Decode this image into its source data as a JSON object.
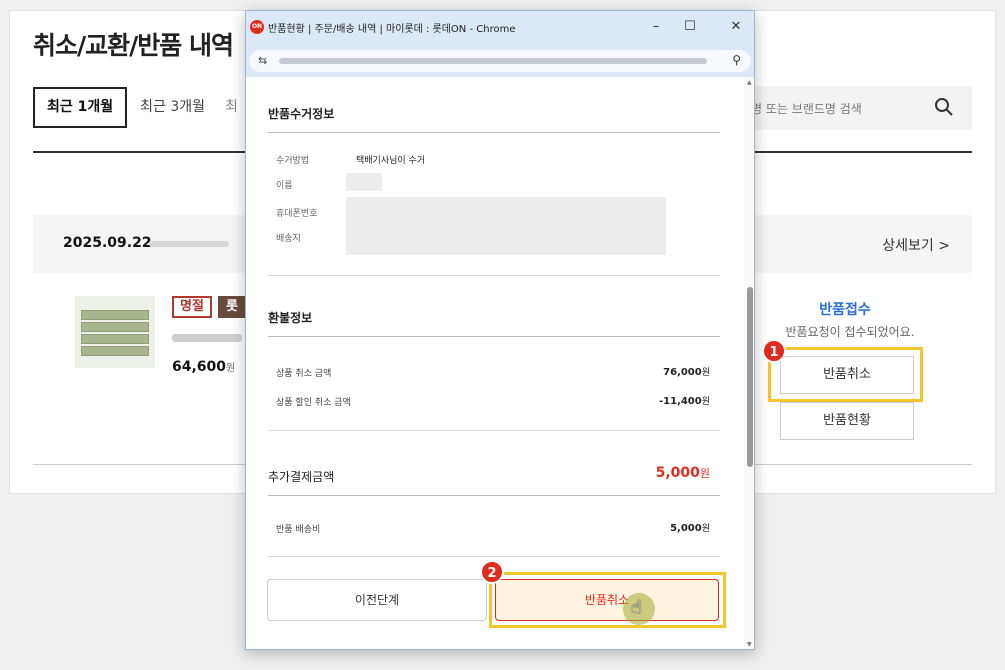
{
  "page": {
    "title": "취소/교환/반품 내역",
    "period_tabs": [
      "최근 1개월",
      "최근 3개월",
      "최"
    ],
    "search_placeholder": "품명 또는 브랜드명 검색",
    "order": {
      "date": "2025.09.22",
      "detail_link": "상세보기 >"
    },
    "product": {
      "badge1": "명절",
      "badge2": "롯",
      "price": "64,600",
      "price_unit": "원"
    },
    "return_status": "반품접수",
    "return_status_msg": "반품요청이 접수되었어요.",
    "buttons": {
      "cancel_return": "반품취소",
      "return_status": "반품현황"
    },
    "steps": [
      "1",
      "2"
    ]
  },
  "popup": {
    "favicon_label": "ON",
    "window_title": "반품현황 | 주문/배송 내역 | 마이롯데 : 롯데ON - Chrome",
    "controls": {
      "minimize": "–",
      "maximize": "☐",
      "close": "✕"
    },
    "url_tune_icon": "⇆",
    "url_zoom_icon": "⚲",
    "pickup": {
      "title": "반품수거정보",
      "fields": [
        {
          "label": "수거방법",
          "value": "택배기사님이 수거"
        },
        {
          "label": "이름",
          "value": ""
        },
        {
          "label": "휴대폰번호",
          "value": ""
        },
        {
          "label": "배송지",
          "value": ""
        }
      ]
    },
    "refund": {
      "title": "환불정보",
      "rows": [
        {
          "label": "상품 취소 금액",
          "value": "76,000",
          "unit": "원"
        },
        {
          "label": "상품 할인 취소 금액",
          "value": "-11,400",
          "unit": "원"
        }
      ]
    },
    "extra_payment": {
      "title": "추가결제금액",
      "value": "5,000",
      "unit": "원",
      "rows": [
        {
          "label": "반품 배송비",
          "value": "5,000",
          "unit": "원"
        }
      ]
    },
    "buttons": {
      "prev": "이전단계",
      "cancel_return": "반품취소"
    }
  },
  "colors": {
    "accent_red": "#e02c1e",
    "status_blue": "#2b6fd6",
    "highlight_yellow": "#f4c52d"
  }
}
